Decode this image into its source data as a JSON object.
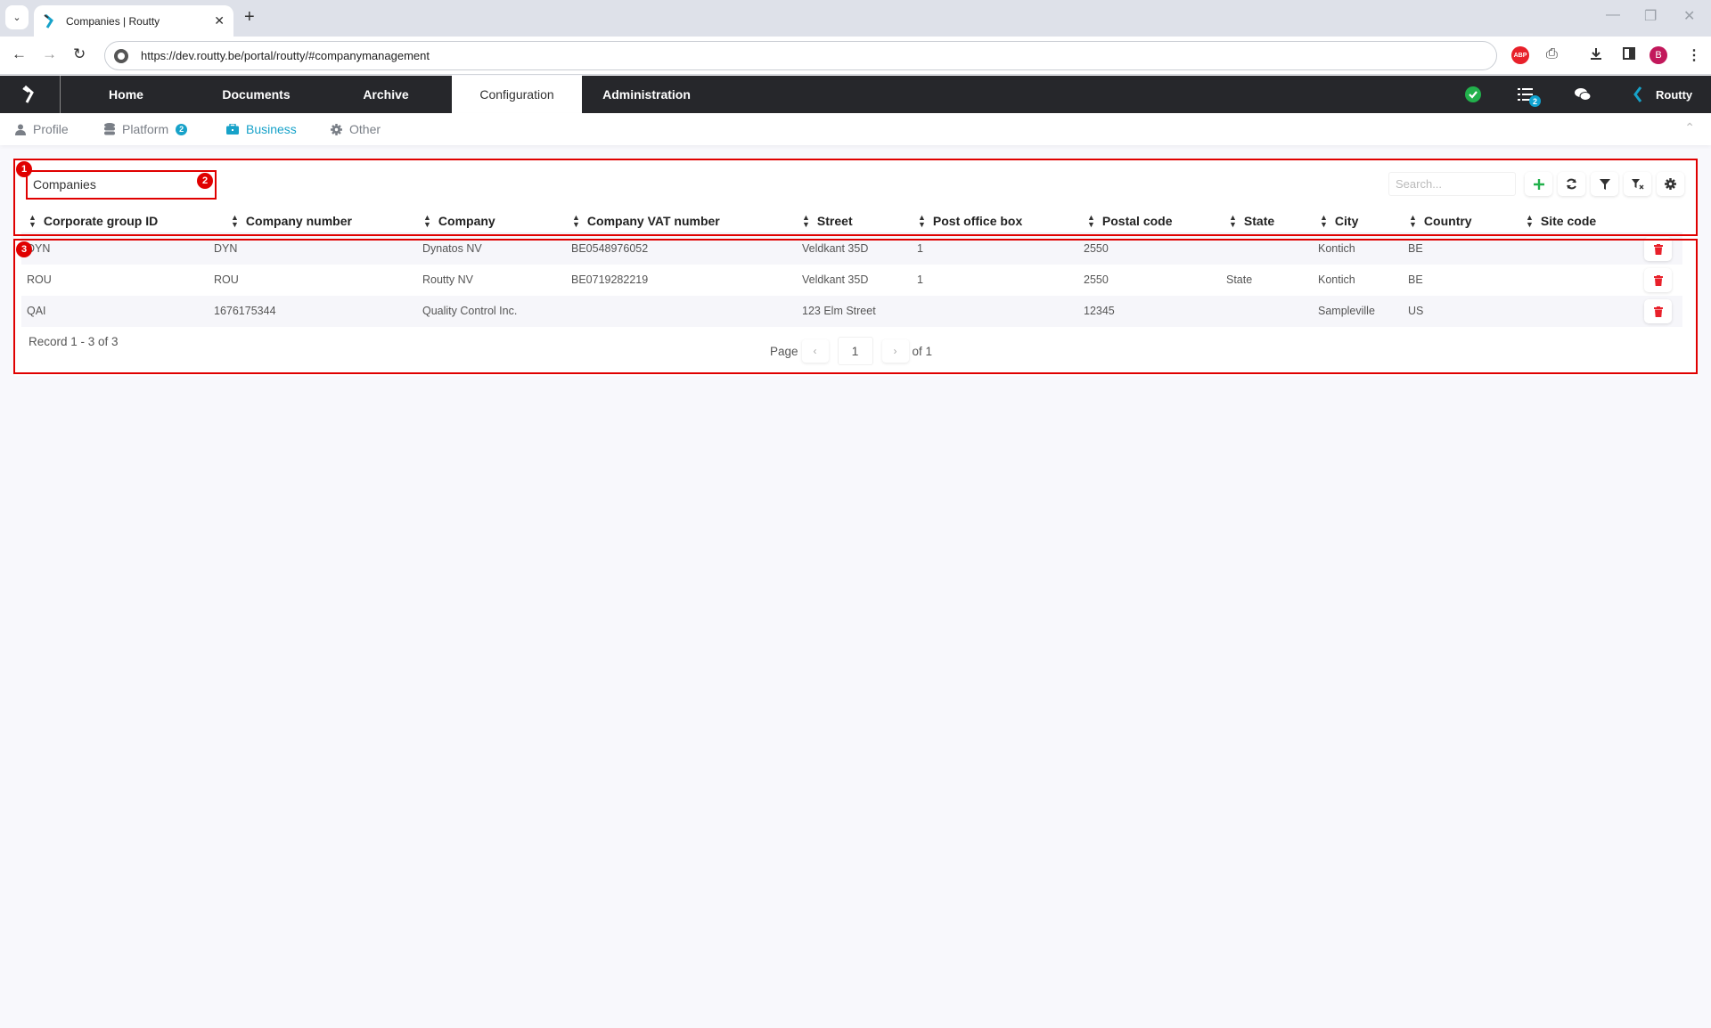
{
  "browser": {
    "tab_title": "Companies | Routty",
    "url": "https://dev.routty.be/portal/routty/#companymanagement",
    "profile_initial": "B",
    "extension_abp": "ABP"
  },
  "navbar": {
    "items": [
      {
        "label": "Home"
      },
      {
        "label": "Documents"
      },
      {
        "label": "Archive"
      },
      {
        "label": "Configuration",
        "active": true
      },
      {
        "label": "Administration"
      }
    ],
    "tasks_badge": "2",
    "user_label": "Routty"
  },
  "subnav": {
    "items": [
      {
        "label": "Profile",
        "icon": "user-icon"
      },
      {
        "label": "Platform",
        "icon": "database-icon",
        "badge": "2"
      },
      {
        "label": "Business",
        "icon": "briefcase-icon",
        "active": true
      },
      {
        "label": "Other",
        "icon": "gear-icon"
      }
    ]
  },
  "grid": {
    "title": "Companies",
    "search_placeholder": "Search...",
    "columns": [
      "Corporate group ID",
      "Company number",
      "Company",
      "Company VAT number",
      "Street",
      "Post office box",
      "Postal code",
      "State",
      "City",
      "Country",
      "Site code"
    ],
    "rows": [
      [
        "DYN",
        "DYN",
        "Dynatos NV",
        "BE0548976052",
        "Veldkant 35D",
        "1",
        "2550",
        "",
        "Kontich",
        "BE",
        ""
      ],
      [
        "ROU",
        "ROU",
        "Routty NV",
        "BE0719282219",
        "Veldkant 35D",
        "1",
        "2550",
        "State",
        "Kontich",
        "BE",
        ""
      ],
      [
        "QAI",
        "1676175344",
        "Quality Control Inc.",
        "",
        "123 Elm Street",
        "",
        "12345",
        "",
        "Sampleville",
        "US",
        ""
      ]
    ],
    "record_text": "Record 1 - 3 of 3",
    "page_label": "Page",
    "page_value": "1",
    "page_of": "of 1"
  },
  "annotations": [
    "1",
    "2",
    "3"
  ],
  "colors": {
    "nav_bg": "#26272b",
    "accent": "#17a2c9",
    "annotation_red": "#e00000",
    "delete_red": "#e8202a",
    "add_green": "#22b14c"
  }
}
